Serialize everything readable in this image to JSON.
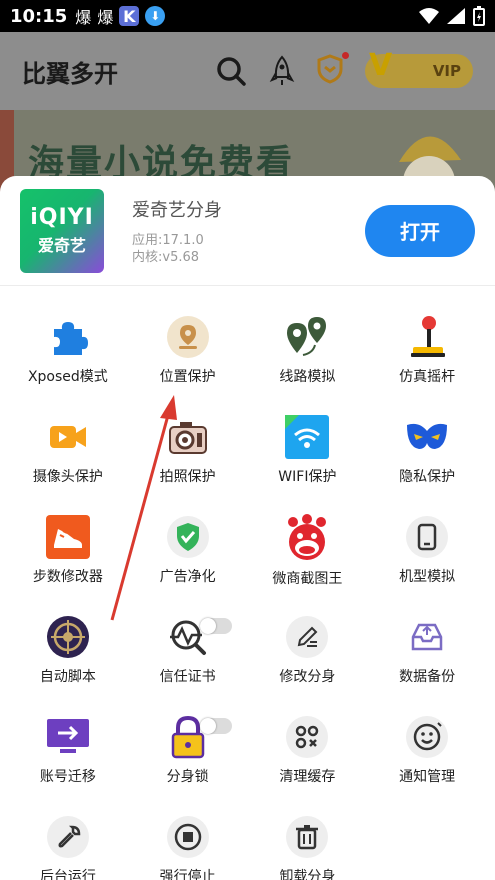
{
  "statusbar": {
    "time": "10:15",
    "icon1": "爆",
    "icon2": "爆",
    "k_badge": "K"
  },
  "header": {
    "title": "比翼多开",
    "vip_label": "VIP"
  },
  "banner": {
    "text": "海量小说免费看"
  },
  "app": {
    "logo_line1": "iQIYI",
    "logo_line2": "爱奇艺",
    "name": "爱奇艺分身",
    "version": "应用:17.1.0",
    "kernel": "内核:v5.68",
    "open_label": "打开"
  },
  "features": [
    {
      "label": "Xposed模式",
      "icon": "puzzle-icon"
    },
    {
      "label": "位置保护",
      "icon": "location-pin-icon"
    },
    {
      "label": "线路模拟",
      "icon": "route-pins-icon"
    },
    {
      "label": "仿真摇杆",
      "icon": "joystick-icon"
    },
    {
      "label": "摄像头保护",
      "icon": "video-camera-icon"
    },
    {
      "label": "拍照保护",
      "icon": "photo-camera-icon"
    },
    {
      "label": "WIFI保护",
      "icon": "wifi-icon"
    },
    {
      "label": "隐私保护",
      "icon": "mask-icon"
    },
    {
      "label": "步数修改器",
      "icon": "shoe-icon"
    },
    {
      "label": "广告净化",
      "icon": "shield-check-icon"
    },
    {
      "label": "微商截图王",
      "icon": "clown-icon"
    },
    {
      "label": "机型模拟",
      "icon": "phone-device-icon"
    },
    {
      "label": "自动脚本",
      "icon": "crosshair-icon"
    },
    {
      "label": "信任证书",
      "icon": "certificate-scan-icon"
    },
    {
      "label": "修改分身",
      "icon": "edit-pen-icon"
    },
    {
      "label": "数据备份",
      "icon": "backup-tray-icon"
    },
    {
      "label": "账号迁移",
      "icon": "account-transfer-icon"
    },
    {
      "label": "分身锁",
      "icon": "padlock-icon"
    },
    {
      "label": "清理缓存",
      "icon": "clean-grid-icon"
    },
    {
      "label": "通知管理",
      "icon": "smiley-notice-icon"
    },
    {
      "label": "后台运行",
      "icon": "wrench-icon"
    },
    {
      "label": "强行停止",
      "icon": "stop-icon"
    },
    {
      "label": "卸载分身",
      "icon": "trash-icon"
    }
  ],
  "colors": {
    "accent": "#1f86f0",
    "annotation": "#d93a2f"
  }
}
